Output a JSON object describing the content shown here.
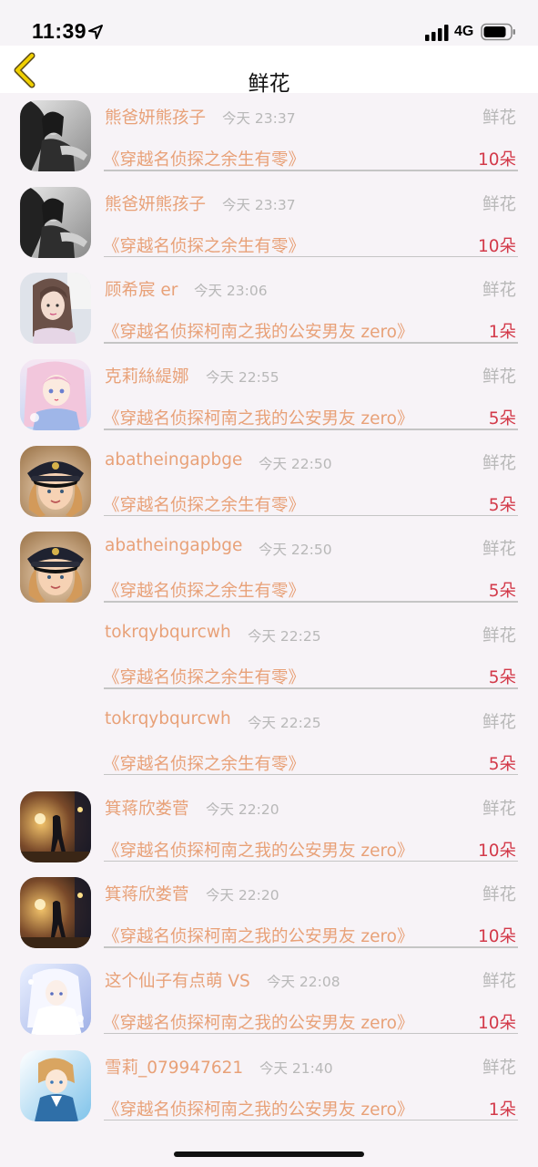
{
  "status": {
    "time": "11:39",
    "network": "4G"
  },
  "nav": {
    "title": "鲜花"
  },
  "rows": [
    {
      "name": "熊爸妍熊孩子",
      "time": "今天 23:37",
      "type": "鲜花",
      "book": "《穿越名侦探之余生有零》",
      "count": "10朵",
      "avatar": "bw-girl-photo"
    },
    {
      "name": "熊爸妍熊孩子",
      "time": "今天 23:37",
      "type": "鲜花",
      "book": "《穿越名侦探之余生有零》",
      "count": "10朵",
      "avatar": "bw-girl-photo"
    },
    {
      "name": "顾希宸 er",
      "time": "今天 23:06",
      "type": "鲜花",
      "book": "《穿越名侦探柯南之我的公安男友 zero》",
      "count": "1朵",
      "avatar": "girl-selfie"
    },
    {
      "name": "克莉絲緹娜",
      "time": "今天 22:55",
      "type": "鲜花",
      "book": "《穿越名侦探柯南之我的公安男友 zero》",
      "count": "5朵",
      "avatar": "anime-pink-hair"
    },
    {
      "name": "abatheingapbge",
      "time": "今天 22:50",
      "type": "鲜花",
      "book": "《穿越名侦探之余生有零》",
      "count": "5朵",
      "avatar": "child-captain-hat"
    },
    {
      "name": "abatheingapbge",
      "time": "今天 22:50",
      "type": "鲜花",
      "book": "《穿越名侦探之余生有零》",
      "count": "5朵",
      "avatar": "child-captain-hat"
    },
    {
      "name": "tokrqybqurcwh",
      "time": "今天 22:25",
      "type": "鲜花",
      "book": "《穿越名侦探之余生有零》",
      "count": "5朵",
      "avatar": "none"
    },
    {
      "name": "tokrqybqurcwh",
      "time": "今天 22:25",
      "type": "鲜花",
      "book": "《穿越名侦探之余生有零》",
      "count": "5朵",
      "avatar": "none"
    },
    {
      "name": "箕蒋欣娄菅",
      "time": "今天 22:20",
      "type": "鲜花",
      "book": "《穿越名侦探柯南之我的公安男友 zero》",
      "count": "10朵",
      "avatar": "night-street"
    },
    {
      "name": "箕蒋欣娄菅",
      "time": "今天 22:20",
      "type": "鲜花",
      "book": "《穿越名侦探柯南之我的公安男友 zero》",
      "count": "10朵",
      "avatar": "night-street"
    },
    {
      "name": "这个仙子有点萌 VS",
      "time": "今天 22:08",
      "type": "鲜花",
      "book": "《穿越名侦探柯南之我的公安男友 zero》",
      "count": "10朵",
      "avatar": "anime-white-dress"
    },
    {
      "name": "雪莉_079947621",
      "time": "今天 21:40",
      "type": "鲜花",
      "book": "《穿越名侦探柯南之我的公安男友 zero》",
      "count": "1朵",
      "avatar": "anime-blue-boy"
    }
  ],
  "colors": {
    "name": "#e8a178",
    "meta": "#b8b8b8",
    "count": "#d33a4a",
    "back_arrow": "#f0d000"
  }
}
